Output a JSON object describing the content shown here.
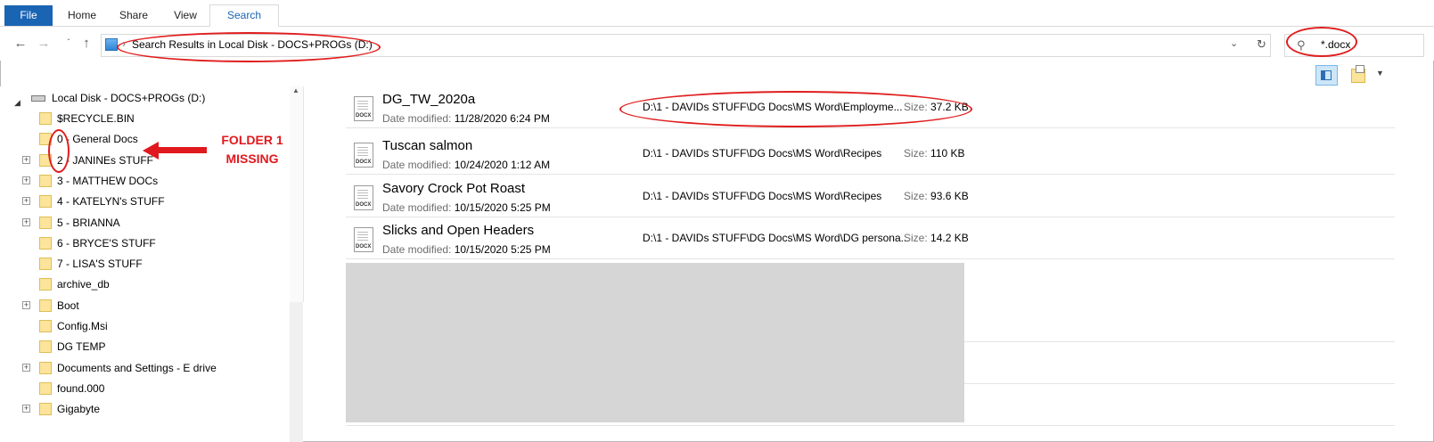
{
  "ribbon": {
    "tabs": [
      {
        "label": "File"
      },
      {
        "label": "Home"
      },
      {
        "label": "Share"
      },
      {
        "label": "View"
      },
      {
        "label": "Search"
      }
    ]
  },
  "navbar": {
    "address": "Search Results in Local Disk - DOCS+PROGs (D:)",
    "search_query": "*.docx"
  },
  "tree": {
    "root": "Local Disk - DOCS+PROGs (D:)",
    "items": [
      {
        "label": "$RECYCLE.BIN",
        "expandable": false
      },
      {
        "label": "0 - General Docs",
        "expandable": false
      },
      {
        "label": "2 - JANINEs STUFF",
        "expandable": true
      },
      {
        "label": "3 - MATTHEW DOCs",
        "expandable": true
      },
      {
        "label": "4 - KATELYN's STUFF",
        "expandable": true
      },
      {
        "label": "5 - BRIANNA",
        "expandable": true
      },
      {
        "label": "6 - BRYCE'S STUFF",
        "expandable": false
      },
      {
        "label": "7 - LISA'S STUFF",
        "expandable": false
      },
      {
        "label": "archive_db",
        "expandable": false
      },
      {
        "label": "Boot",
        "expandable": true
      },
      {
        "label": "Config.Msi",
        "expandable": false
      },
      {
        "label": "DG TEMP",
        "expandable": false
      },
      {
        "label": "Documents and Settings - E drive",
        "expandable": true
      },
      {
        "label": "found.000",
        "expandable": false
      },
      {
        "label": "Gigabyte",
        "expandable": true
      }
    ]
  },
  "results": {
    "date_modified_label": "Date modified:",
    "size_label": "Size:",
    "file_type_tag": "DOCX",
    "files": [
      {
        "name": "DG_TW_2020a",
        "date": "11/28/2020 6:24 PM",
        "path": "D:\\1 - DAVIDs STUFF\\DG Docs\\MS Word\\Employme...",
        "size": "37.2 KB"
      },
      {
        "name": "Tuscan salmon",
        "date": "10/24/2020 1:12 AM",
        "path": "D:\\1 - DAVIDs STUFF\\DG Docs\\MS Word\\Recipes",
        "size": "110 KB"
      },
      {
        "name": "Savory Crock Pot Roast",
        "date": "10/15/2020 5:25 PM",
        "path": "D:\\1 - DAVIDs STUFF\\DG Docs\\MS Word\\Recipes",
        "size": "93.6 KB"
      },
      {
        "name": "Slicks and Open Headers",
        "date": "10/15/2020 5:25 PM",
        "path": "D:\\1 - DAVIDs STUFF\\DG Docs\\MS Word\\DG persona...",
        "size": "14.2 KB"
      }
    ]
  },
  "annotation": {
    "line1": "FOLDER 1",
    "line2": "MISSING",
    "color": "#e0191e"
  },
  "icons": {
    "back": "back-arrow-icon",
    "forward": "forward-arrow-icon",
    "up": "up-arrow-icon",
    "refresh": "refresh-icon",
    "search": "search-icon",
    "folder": "folder-icon",
    "drive": "drive-icon",
    "document": "docx-file-icon"
  }
}
